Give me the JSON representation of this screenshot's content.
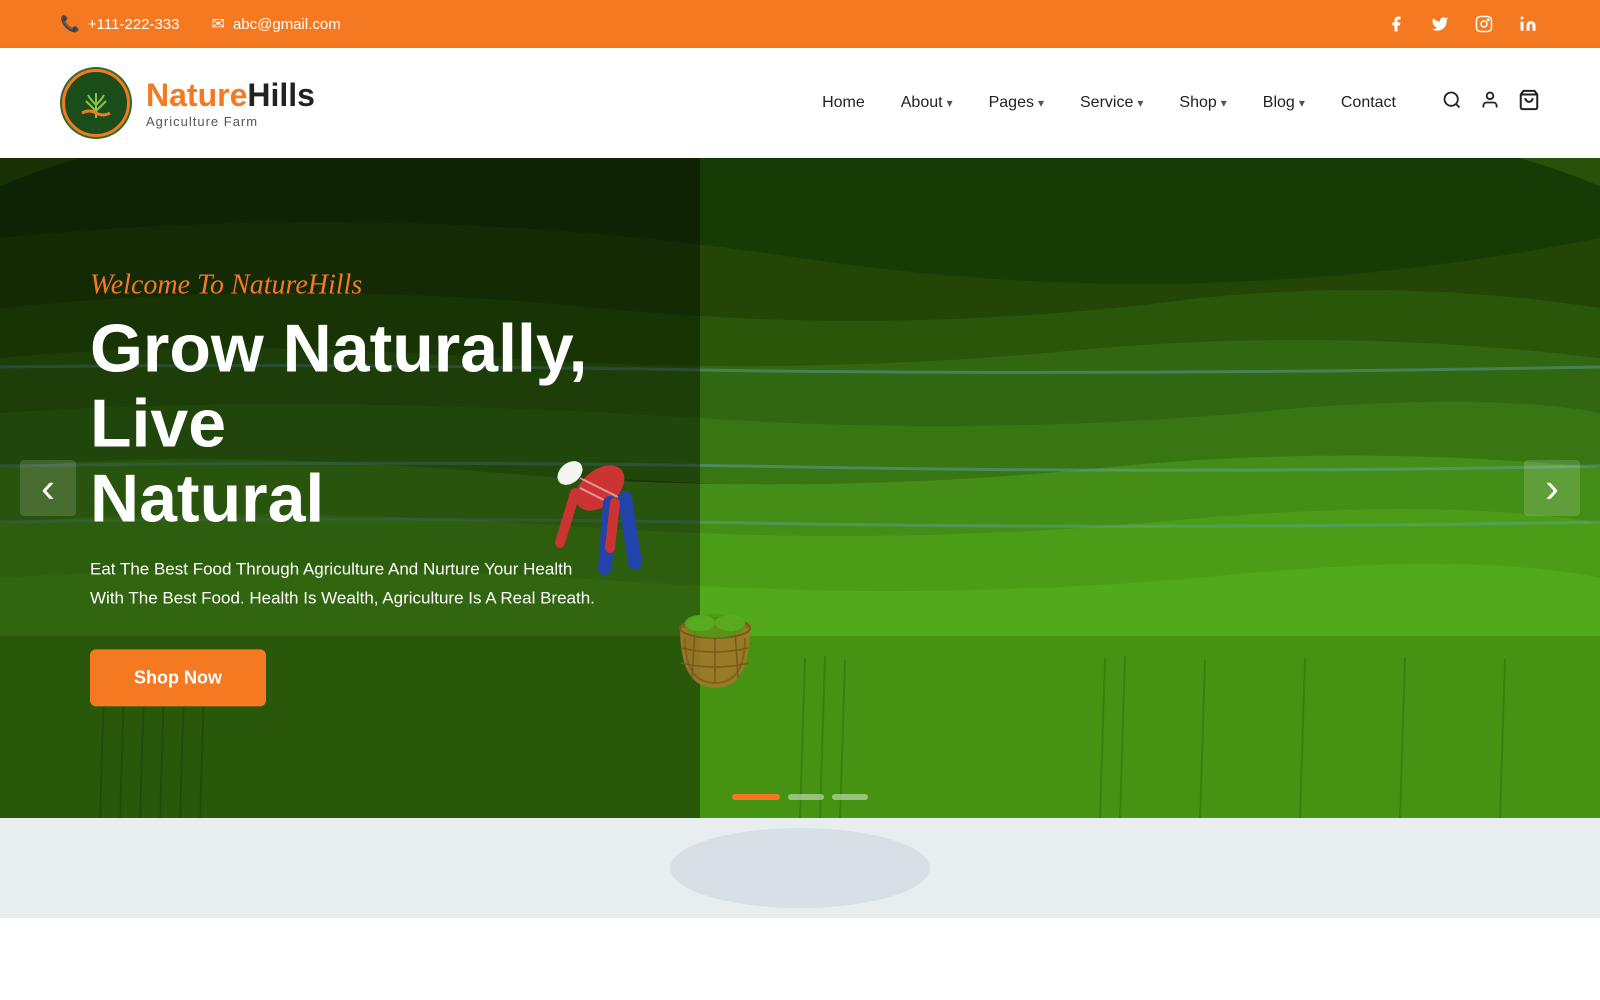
{
  "topbar": {
    "phone": "+111-222-333",
    "email": "abc@gmail.com",
    "socials": [
      "facebook",
      "twitter",
      "instagram",
      "linkedin"
    ]
  },
  "logo": {
    "name_part1": "Nature",
    "name_part2": "Hills",
    "subtitle": "Agriculture Farm"
  },
  "nav": {
    "items": [
      {
        "label": "Home",
        "has_dropdown": false
      },
      {
        "label": "About",
        "has_dropdown": true
      },
      {
        "label": "Pages",
        "has_dropdown": true
      },
      {
        "label": "Service",
        "has_dropdown": true
      },
      {
        "label": "Shop",
        "has_dropdown": true
      },
      {
        "label": "Blog",
        "has_dropdown": true
      },
      {
        "label": "Contact",
        "has_dropdown": false
      }
    ]
  },
  "hero": {
    "welcome_text": "Welcome To NatureHills",
    "title_line1": "Grow Naturally, Live",
    "title_line2": "Natural",
    "description": "Eat The Best Food Through Agriculture And Nurture Your Health With The Best Food. Health Is Wealth, Agriculture Is A Real Breath.",
    "cta_label": "Shop Now",
    "arrow_left": "‹",
    "arrow_right": "›",
    "dots": [
      {
        "active": true
      },
      {
        "active": false
      },
      {
        "active": false
      }
    ]
  },
  "colors": {
    "orange": "#F47920",
    "dark_green": "#2d6a2d",
    "white": "#ffffff"
  }
}
